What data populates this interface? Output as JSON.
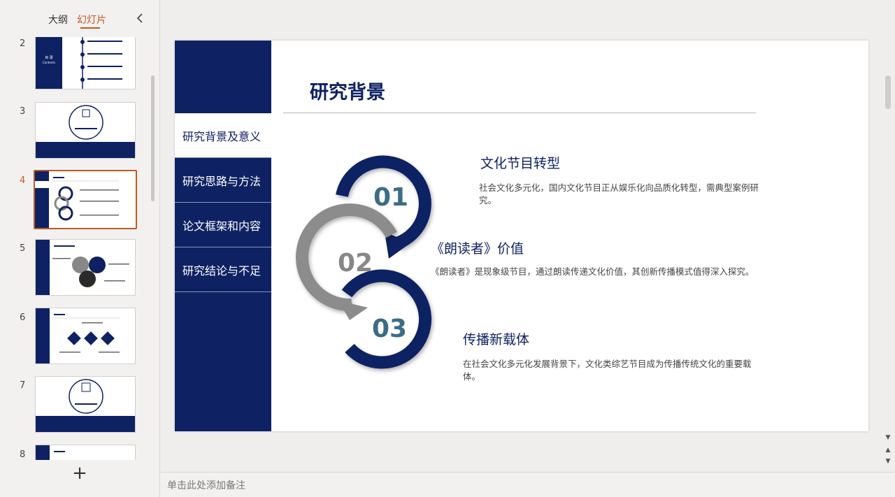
{
  "left_panel": {
    "tab_outline": "大纲",
    "tab_slides": "幻灯片",
    "add_slide": "+",
    "slides": [
      {
        "num": "2"
      },
      {
        "num": "3"
      },
      {
        "num": "4",
        "active": true
      },
      {
        "num": "5"
      },
      {
        "num": "6"
      },
      {
        "num": "7"
      },
      {
        "num": "8"
      }
    ]
  },
  "slide": {
    "sidebar": [
      "研究背景及意义",
      "研究思路与方法",
      "论文框架和内容",
      "研究结论与不足"
    ],
    "title": "研究背景",
    "items": [
      {
        "number": "01",
        "heading": "文化节目转型",
        "body": "社会文化多元化，国内文化节目正从娱乐化向品质化转型，需典型案例研究。"
      },
      {
        "number": "02",
        "heading": "《朗读者》价值",
        "body": "《朗读者》是现象级节目，通过朗读传递文化价值，其创新传播模式值得深入探究。"
      },
      {
        "number": "03",
        "heading": "传播新载体",
        "body": "在社会文化多元化发展背景下，文化类综艺节目成为传播传统文化的重要载体。"
      }
    ]
  },
  "notes": {
    "placeholder": "单击此处添加备注"
  },
  "colors": {
    "navy": "#0e2263",
    "accent": "#c3581f",
    "gray": "#8c8c8c",
    "number_teal": "#3d6d84"
  }
}
